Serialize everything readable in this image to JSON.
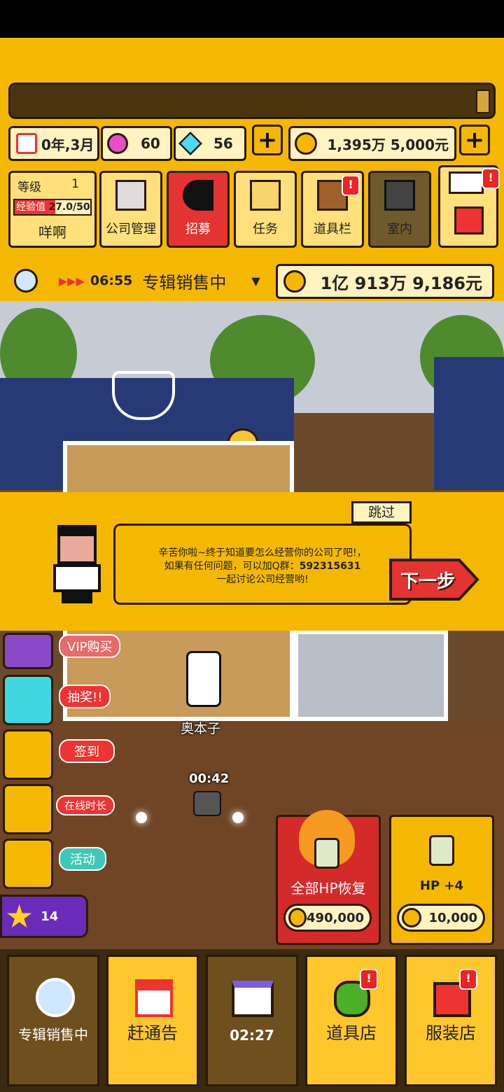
{
  "status": {
    "date": "0年,3月",
    "gems_pink": "60",
    "gems_blue": "56",
    "money": "1,395万 5,000元",
    "level_label": "等级",
    "level_value": "1",
    "exp_label": "经验值",
    "exp_value": "27.0/50",
    "exp_fraction": 0.54,
    "player_name": "咩啊"
  },
  "menu": [
    "公司管理",
    "招募",
    "任务",
    "道具栏",
    "室内"
  ],
  "album": {
    "timer": "06:55",
    "status": "专辑销售中",
    "revenue": "1亿 913万 9,186元"
  },
  "dialog": {
    "skip": "跳过",
    "message_line1": "辛苦你啦~终于知道要怎么经营你的公司了吧!，",
    "message_line2": "如果有任何问题，可以加Q群：",
    "qq_group": "592315631",
    "message_line3": "一起讨论公司经营哟!",
    "next": "下一步"
  },
  "side_menu": {
    "vip": "VIP购买",
    "lottery": "抽奖!!",
    "checkin": "签到",
    "online": "在线时长",
    "event": "活动",
    "stars": "14"
  },
  "scene": {
    "character_name": "奥本子",
    "timer": "00:42"
  },
  "shop": {
    "full_hp_label": "全部HP恢复",
    "full_hp_price": "490,000",
    "hp_plus_label": "HP +4",
    "hp_plus_price": "10,000"
  },
  "bottom_nav": [
    "专辑销售中",
    "赶通告",
    "02:27",
    "道具店",
    "服装店"
  ],
  "colors": {
    "accent": "#f5b800",
    "red": "#e33333",
    "dark_brown": "#2a1a05"
  }
}
